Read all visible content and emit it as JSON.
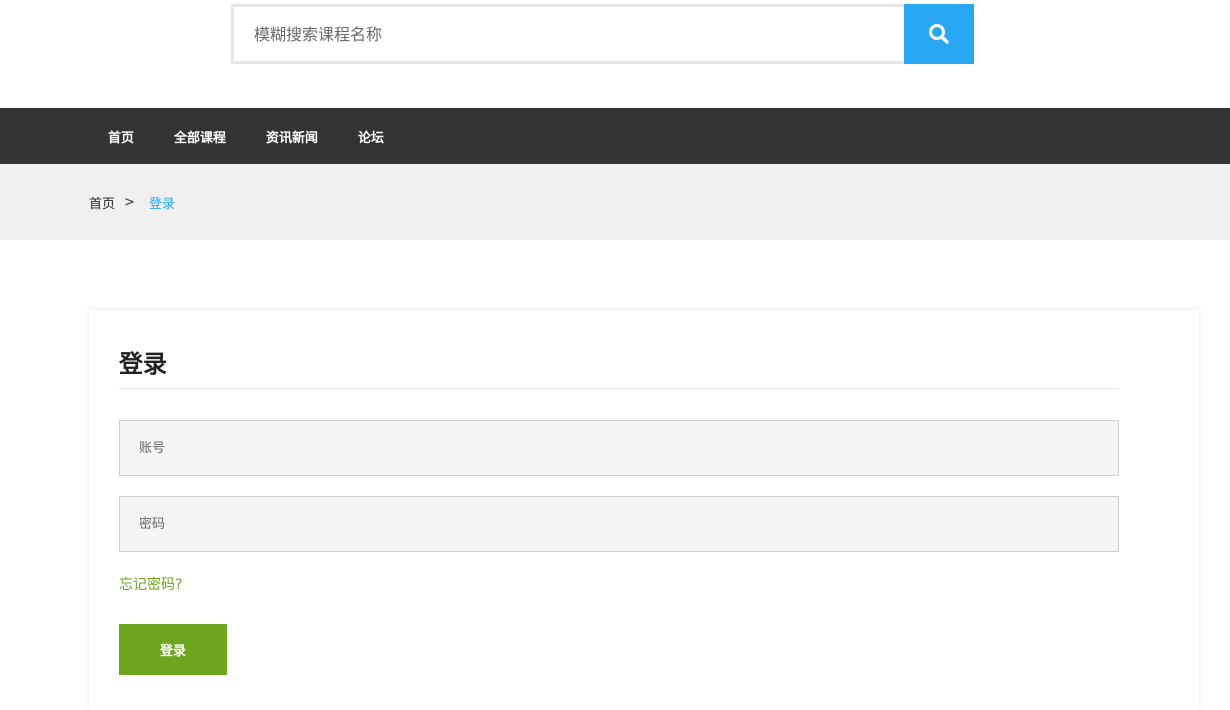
{
  "search": {
    "placeholder": "模糊搜索课程名称",
    "button_icon": "search-icon",
    "button_color": "#2aa7f2"
  },
  "nav": {
    "items": [
      "首页",
      "全部课程",
      "资讯新闻",
      "论坛"
    ],
    "background": "#333333"
  },
  "breadcrumb": {
    "home": "首页",
    "separator": ">",
    "current": "登录",
    "current_color": "#2aa7f2"
  },
  "login": {
    "title": "登录",
    "account_placeholder": "账号",
    "password_placeholder": "密码",
    "forgot_label": "忘记密码?",
    "submit_label": "登录",
    "accent": "#6ea51f"
  }
}
